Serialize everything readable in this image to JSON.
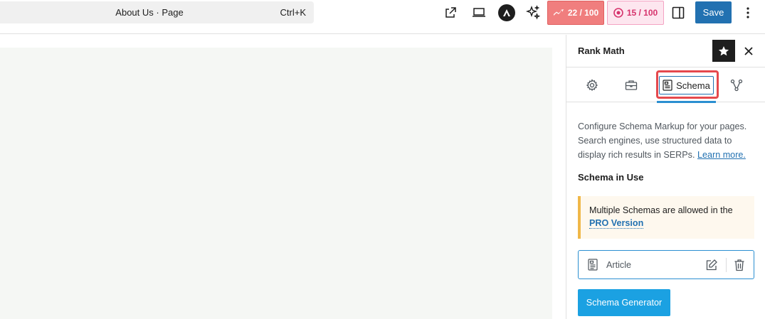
{
  "command_bar": {
    "title": "About Us · Page",
    "shortcut": "Ctrl+K"
  },
  "toolbar": {
    "icons": [
      "external-link-icon",
      "desktop-preview-icon",
      "astra-logo-icon",
      "sparkles-icon"
    ],
    "seo_score": "22 / 100",
    "content_score": "15 / 100",
    "save_label": "Save"
  },
  "sidebar": {
    "title": "Rank Math",
    "tabs": [
      {
        "icon": "gear-icon"
      },
      {
        "icon": "briefcase-icon"
      },
      {
        "icon": "schema-icon",
        "label": "Schema",
        "active": true
      },
      {
        "icon": "share-nodes-icon"
      }
    ],
    "description": "Configure Schema Markup for your pages. Search engines, use structured data to display rich results in SERPs.",
    "learn_more": "Learn more.",
    "section_title": "Schema in Use",
    "notice_text": "Multiple Schemas are allowed in the",
    "notice_link": "PRO Version",
    "schema_items": [
      {
        "name": "Article"
      }
    ],
    "generator_button": "Schema Generator"
  },
  "colors": {
    "primary": "#2271b1",
    "accent_blue": "#2b8fd1",
    "seo_score_bg": "#f07e7e",
    "content_score_bg": "#fde6ef",
    "highlight": "#e5484d",
    "notice_border": "#f0b849"
  }
}
